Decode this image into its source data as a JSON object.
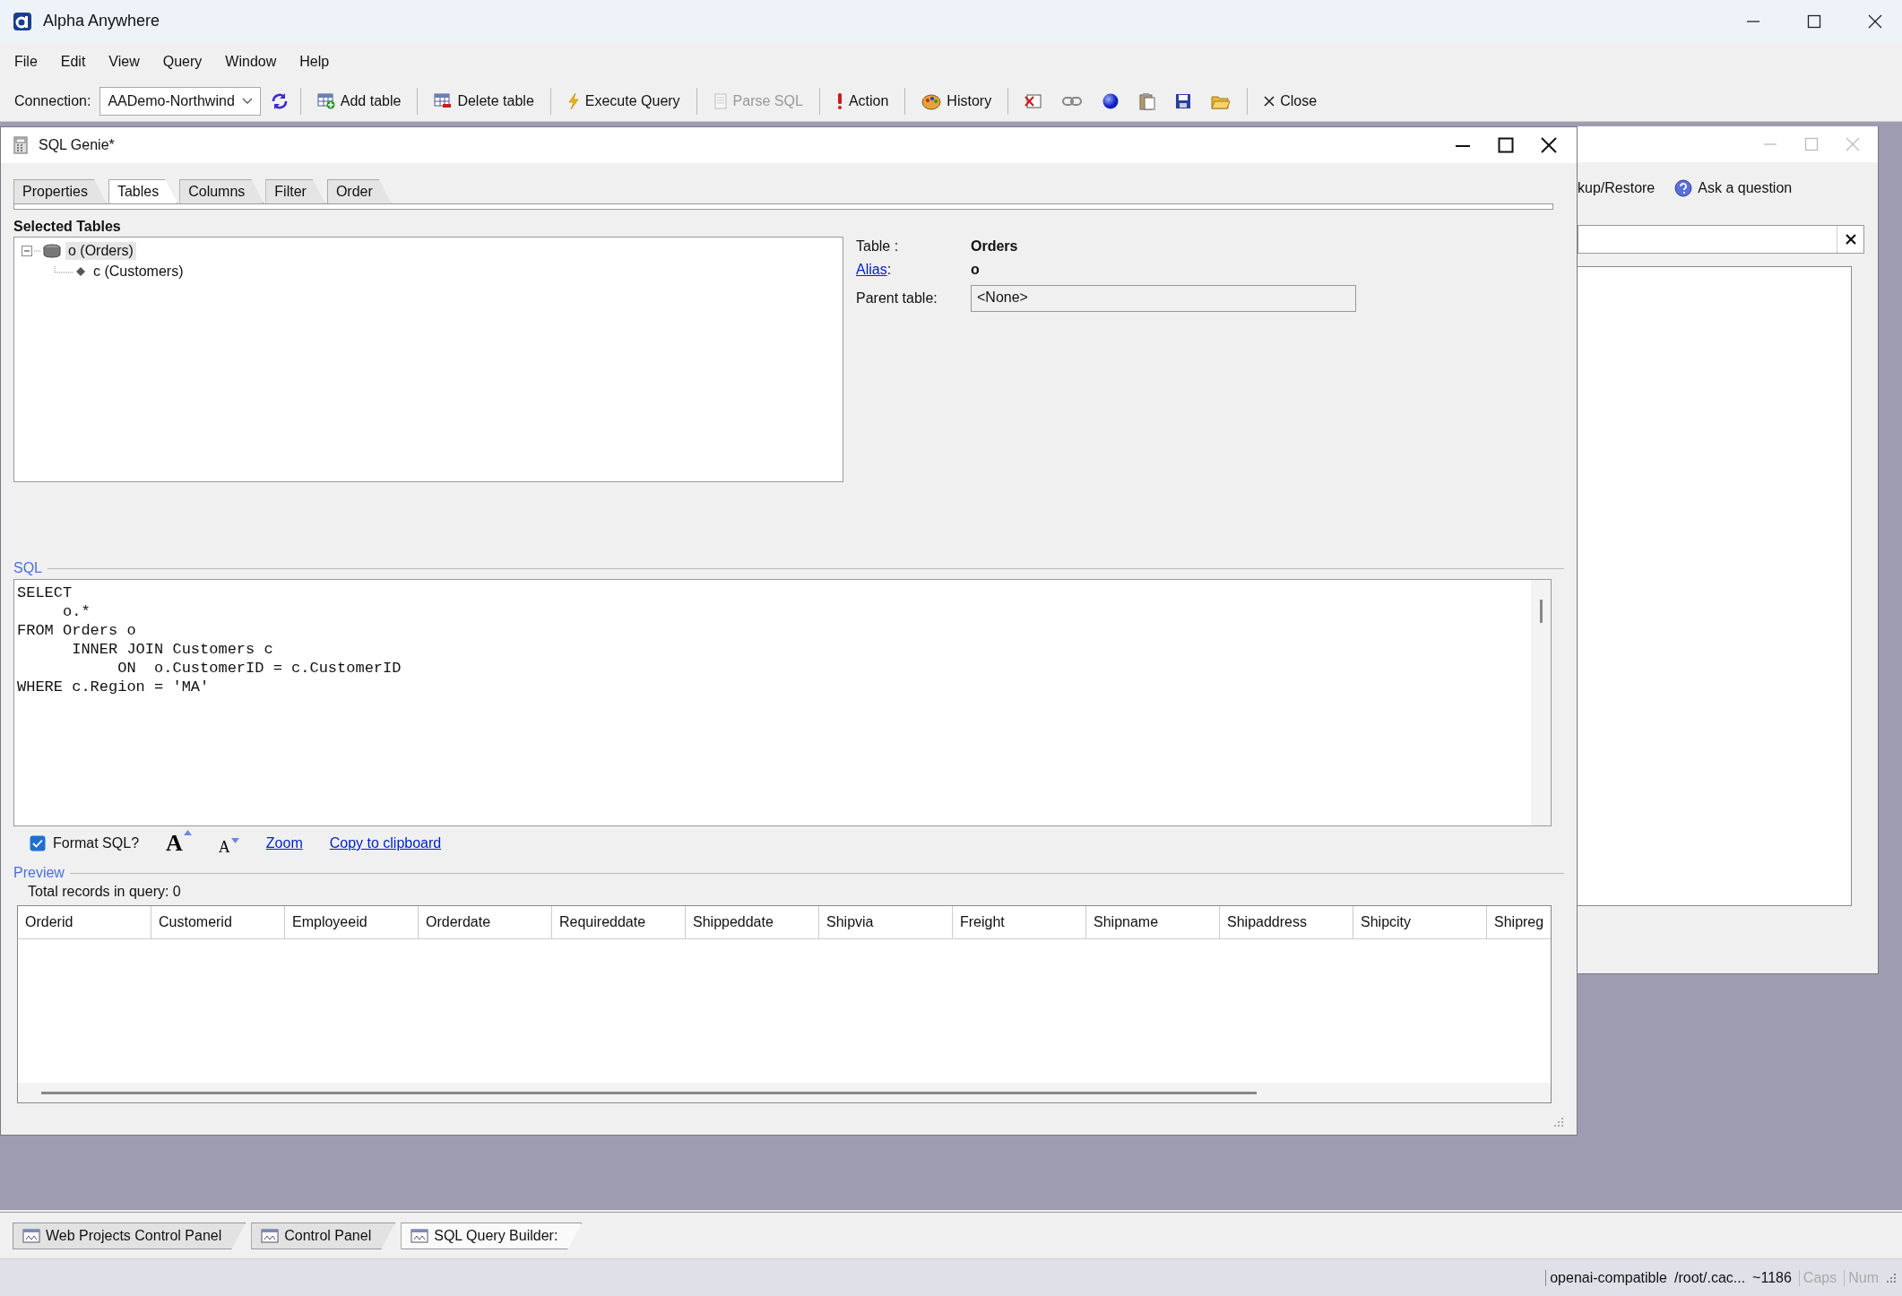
{
  "window": {
    "title": "Alpha Anywhere"
  },
  "menu": [
    {
      "label": "File"
    },
    {
      "label": "Edit"
    },
    {
      "label": "View"
    },
    {
      "label": "Query"
    },
    {
      "label": "Window"
    },
    {
      "label": "Help"
    }
  ],
  "toolbar": {
    "connection_label": "Connection:",
    "connection": "AADemo-Northwind",
    "buttons": [
      {
        "label": "Add table",
        "disabled": false
      },
      {
        "label": "Delete table",
        "disabled": false
      },
      {
        "label": "Execute Query",
        "disabled": false
      },
      {
        "label": "Parse SQL",
        "disabled": true
      },
      {
        "label": "Action",
        "disabled": false
      },
      {
        "label": "History",
        "disabled": false
      }
    ],
    "close": "Close"
  },
  "sql_genie": {
    "title": "SQL Genie*",
    "tabs": [
      {
        "label": "Properties",
        "selected": false
      },
      {
        "label": "Tables",
        "selected": true
      },
      {
        "label": "Columns",
        "selected": false
      },
      {
        "label": "Filter",
        "selected": false
      },
      {
        "label": "Order",
        "selected": false
      }
    ],
    "selected_tables_label": "Selected Tables",
    "tree": [
      {
        "label": "o (Orders)",
        "expanded": true,
        "selected": true,
        "children": [
          {
            "label": "c (Customers)",
            "selected": false
          }
        ]
      }
    ],
    "table_label": "Table :",
    "table_value": "Orders",
    "alias_link": "Alias",
    "alias_suffix": ":",
    "alias_value": "o",
    "parent_table_label": "Parent table:",
    "parent_table_value": "<None>",
    "sql_label": "SQL",
    "sql_lines": [
      "SELECT",
      "     o.*",
      "FROM Orders o",
      "      INNER JOIN Customers c",
      "           ON  o.CustomerID = c.CustomerID",
      "WHERE c.Region = 'MA'"
    ],
    "format_sql": {
      "label": "Format SQL?",
      "checked": true
    },
    "font_larger": "A",
    "font_smaller": "A",
    "zoom_link": "Zoom",
    "copy_link": "Copy to clipboard",
    "preview_label": "Preview",
    "total_records": "Total records in query: 0",
    "columns": [
      "Orderid",
      "Customerid",
      "Employeeid",
      "Orderdate",
      "Requireddate",
      "Shippeddate",
      "Shipvia",
      "Freight",
      "Shipname",
      "Shipaddress",
      "Shipcity",
      "Shipreg"
    ]
  },
  "back_window": {
    "link": "kup/Restore",
    "ask": "Ask a question"
  },
  "window_tabs": [
    {
      "label": "Web Projects Control Panel",
      "selected": false
    },
    {
      "label": "Control Panel",
      "selected": false
    },
    {
      "label": "SQL Query Builder:",
      "selected": true
    }
  ],
  "status_bar": {
    "items": [
      "openai-compatible",
      "/root/.cac...",
      "~1186"
    ],
    "caps": {
      "label": "Caps",
      "on": false
    },
    "num": {
      "label": "Num",
      "on": false
    }
  }
}
